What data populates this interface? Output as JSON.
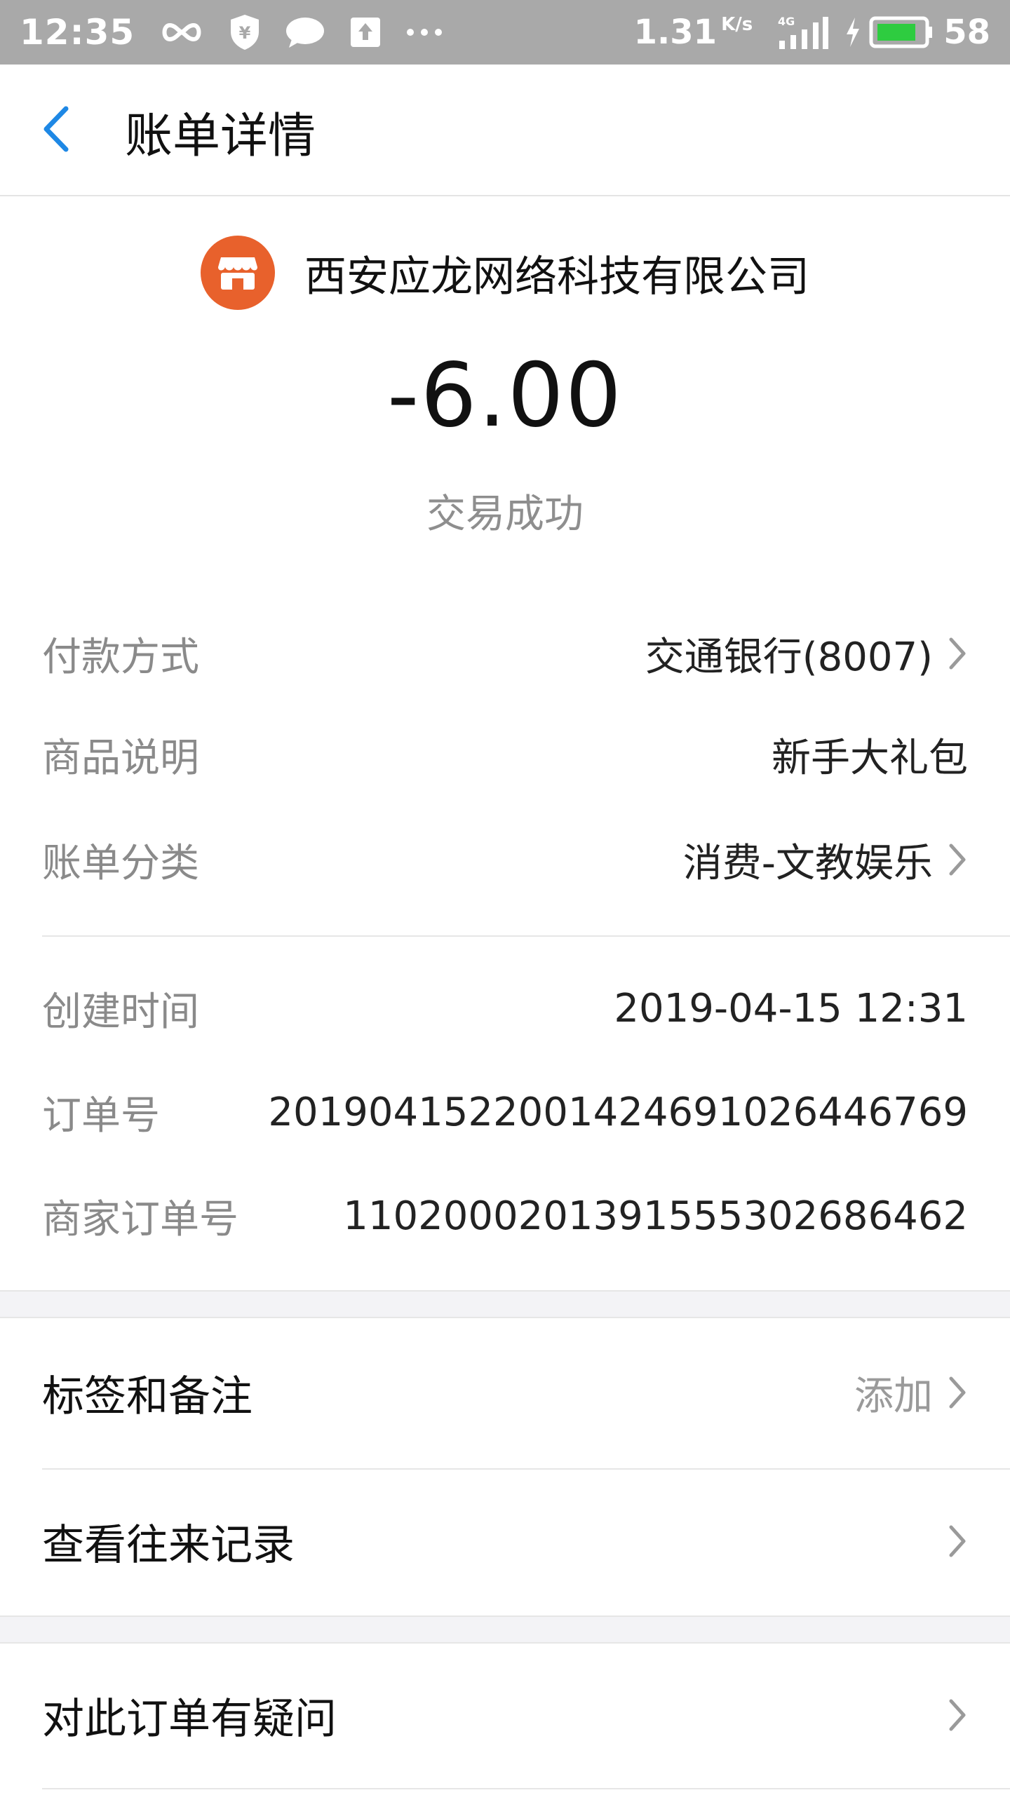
{
  "status_bar": {
    "time": "12:35",
    "speed": "1.31",
    "speed_unit": "K/s",
    "network": "4G",
    "battery": "58",
    "icons": [
      "infinity-icon",
      "shield-yen-icon",
      "message-icon",
      "upload-icon",
      "more-dots-icon",
      "signal-icon",
      "charging-icon",
      "battery-icon"
    ]
  },
  "header": {
    "back_icon": "chevron-left-icon",
    "title": "账单详情"
  },
  "merchant": {
    "icon": "store-icon",
    "name": "西安应龙网络科技有限公司"
  },
  "amount": "-6.00",
  "status": "交易成功",
  "details_group1": [
    {
      "label": "付款方式",
      "value": "交通银行(8007)",
      "chevron": true
    },
    {
      "label": "商品说明",
      "value": "新手大礼包",
      "chevron": false
    },
    {
      "label": "账单分类",
      "value": "消费-文教娱乐",
      "chevron": true
    }
  ],
  "details_group2": [
    {
      "label": "创建时间",
      "value": "2019-04-15 12:31"
    },
    {
      "label": "订单号",
      "value": "20190415220014246910264467​69"
    },
    {
      "label": "商家订单号",
      "value": "110200020139155530268646​2"
    }
  ],
  "actions": {
    "tags_label": "标签和备注",
    "tags_hint": "添加",
    "history_label": "查看往来记录",
    "question_label": "对此订单有疑问"
  },
  "colors": {
    "status_bar_bg": "#a9a9a9",
    "accent_blue": "#1e88e5",
    "merchant_orange": "#e8612c",
    "battery_green": "#2ecc40"
  }
}
